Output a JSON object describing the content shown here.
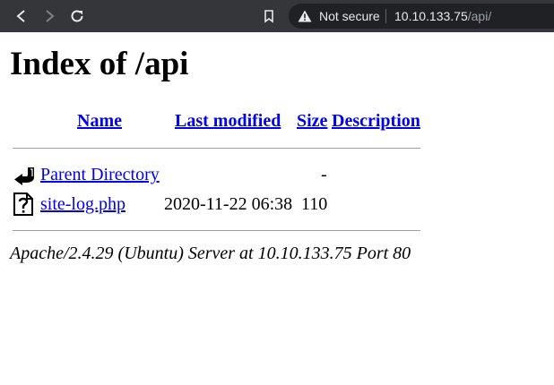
{
  "browser": {
    "security_label": "Not secure",
    "url_host": "10.10.133.75",
    "url_path": "/api/"
  },
  "page": {
    "title": "Index of /api",
    "columns": {
      "name": "Name",
      "last_modified": "Last modified",
      "size": "Size",
      "description": "Description"
    },
    "rows": [
      {
        "icon": "back-arrow-icon",
        "name": "Parent Directory",
        "last_modified": "",
        "size": "-",
        "description": ""
      },
      {
        "icon": "text-file-icon",
        "name": "site-log.php",
        "last_modified": "2020-11-22 06:38",
        "size": "110",
        "description": ""
      }
    ],
    "server_signature": "Apache/2.4.29 (Ubuntu) Server at 10.10.133.75 Port 80"
  },
  "colors": {
    "link": "#0000ee",
    "toolbar_bg": "#35363a",
    "omnibox_bg": "#202124"
  }
}
